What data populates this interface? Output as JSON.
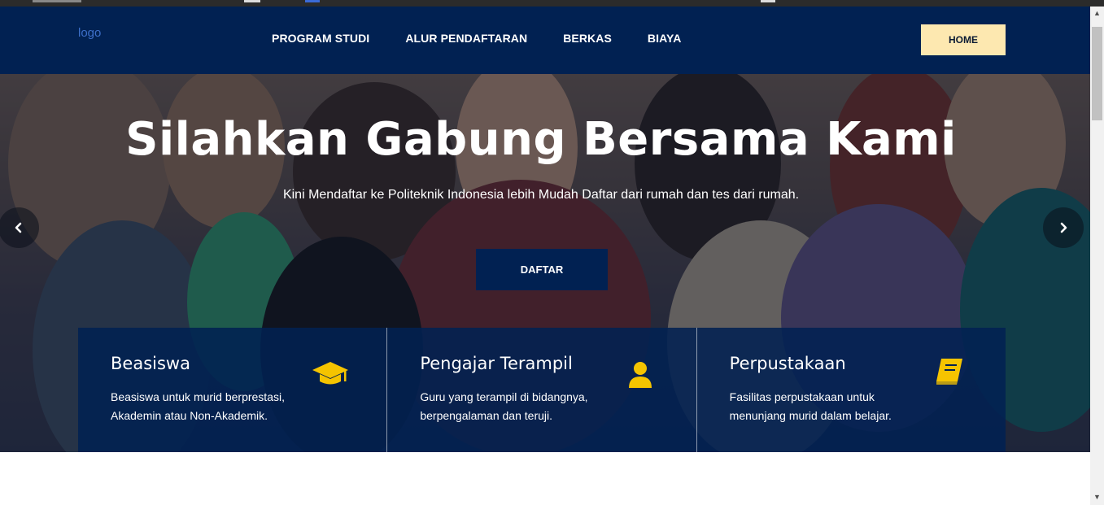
{
  "nav": {
    "logo": "logo",
    "links": [
      "PROGRAM STUDI",
      "ALUR PENDAFTARAN",
      "BERKAS",
      "BIAYA"
    ],
    "home_label": "HOME"
  },
  "hero": {
    "title": "Silahkan Gabung Bersama Kami",
    "subtitle": "Kini Mendaftar ke Politeknik Indonesia lebih Mudah Daftar dari rumah dan tes dari rumah.",
    "cta_label": "DAFTAR"
  },
  "features": [
    {
      "title": "Beasiswa",
      "description": "Beasiswa untuk murid berprestasi, Akademin atau Non-Akademik.",
      "icon": "graduation-cap-icon"
    },
    {
      "title": "Pengajar Terampil",
      "description": "Guru yang terampil di bidangnya, berpengalaman dan teruji.",
      "icon": "user-icon"
    },
    {
      "title": "Perpustakaan",
      "description": "Fasilitas perpustakaan untuk menunjang murid dalam belajar.",
      "icon": "book-icon"
    }
  ],
  "colors": {
    "navy": "#012152",
    "accent_yellow": "#f5c400",
    "home_bg": "#fde8b0"
  }
}
